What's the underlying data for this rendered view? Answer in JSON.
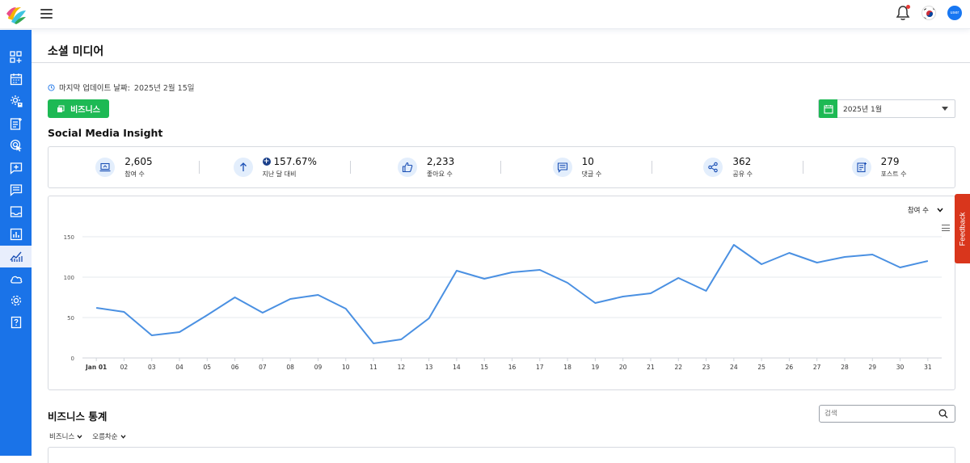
{
  "header": {
    "menu_icon": "hamburger-icon",
    "notification_icon": "bell-icon",
    "language_flag": "korea-flag-icon",
    "avatar_text": "user"
  },
  "sidebar": {
    "items": [
      {
        "icon": "dashboard-add-icon"
      },
      {
        "icon": "calendar-icon"
      },
      {
        "icon": "settings-user-icon"
      },
      {
        "icon": "document-edit-icon"
      },
      {
        "icon": "target-click-icon"
      },
      {
        "icon": "message-add-icon"
      },
      {
        "icon": "chat-list-icon"
      },
      {
        "icon": "inbox-icon"
      },
      {
        "icon": "bar-chart-icon"
      },
      {
        "icon": "trend-chart-icon",
        "active": true
      },
      {
        "icon": "cloud-icon"
      },
      {
        "icon": "gear-icon"
      },
      {
        "icon": "help-book-icon"
      }
    ]
  },
  "page": {
    "title": "소셜 미디어",
    "last_update_label": "마지막 업데이트 날짜:",
    "last_update_value": "2025년 2월 15일",
    "business_button": "비즈니스",
    "date_select": "2025년 1월",
    "insight_title": "Social Media Insight"
  },
  "stats": [
    {
      "icon": "laptop-icon",
      "value": "2,605",
      "label": "참여 수"
    },
    {
      "icon": "arrow-up-icon",
      "value": "157.67%",
      "label": "지난 달 대비",
      "prefix": "+"
    },
    {
      "icon": "thumbs-up-icon",
      "value": "2,233",
      "label": "좋아요 수"
    },
    {
      "icon": "comment-icon",
      "value": "10",
      "label": "댓글 수"
    },
    {
      "icon": "share-icon",
      "value": "362",
      "label": "공유 수"
    },
    {
      "icon": "post-icon",
      "value": "279",
      "label": "포스트 수"
    }
  ],
  "chart_controls": {
    "metric_select": "참여 수"
  },
  "chart_data": {
    "type": "line",
    "x": [
      "Jan 01",
      "02",
      "03",
      "04",
      "05",
      "06",
      "07",
      "08",
      "09",
      "10",
      "11",
      "12",
      "13",
      "14",
      "15",
      "16",
      "17",
      "18",
      "19",
      "20",
      "21",
      "22",
      "23",
      "24",
      "25",
      "26",
      "27",
      "28",
      "29",
      "30",
      "31"
    ],
    "series": [
      {
        "values": [
          62,
          57,
          28,
          32,
          53,
          75,
          56,
          73,
          78,
          61,
          18,
          23,
          49,
          108,
          98,
          106,
          109,
          93,
          68,
          76,
          80,
          99,
          83,
          140,
          116,
          130,
          118,
          125,
          128,
          112,
          120
        ]
      }
    ],
    "ylim": [
      0,
      150
    ],
    "yticks": [
      0,
      50,
      100,
      150
    ],
    "grid": true,
    "color": "#4a90e2"
  },
  "business_stats": {
    "title": "비즈니스 통계",
    "search_placeholder": "검색",
    "filters": [
      "비즈니스",
      "오름차순"
    ]
  },
  "feedback_label": "Feedback"
}
